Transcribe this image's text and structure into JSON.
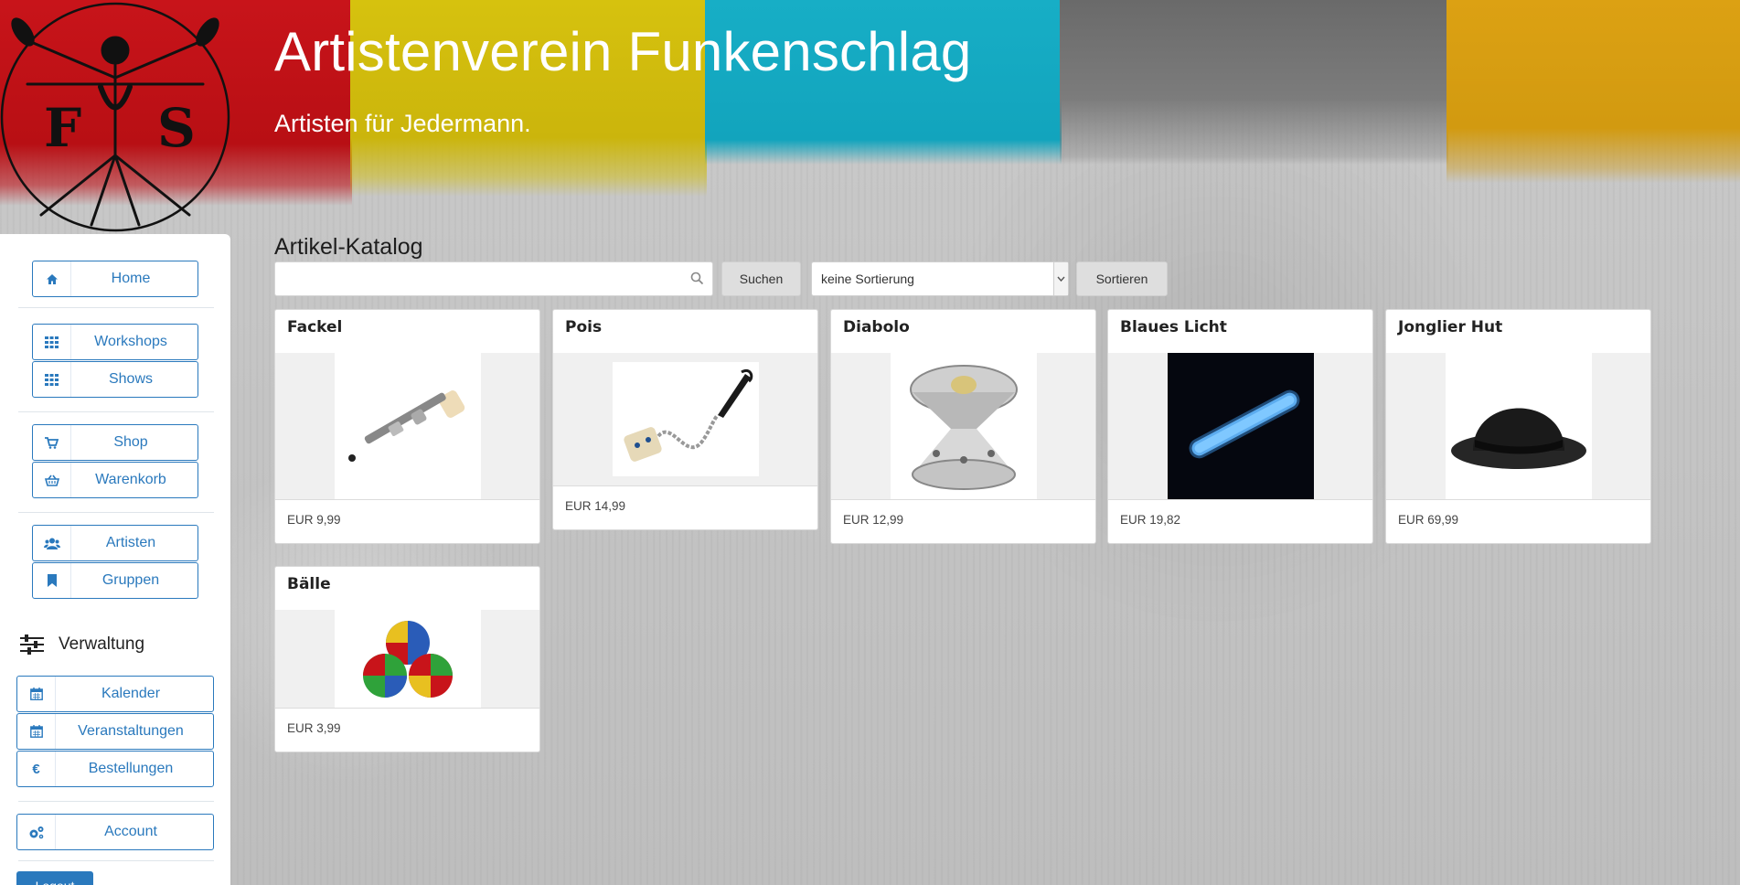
{
  "header": {
    "title": "Artistenverein Funkenschlag",
    "subtitle": "Artisten für Jedermann.",
    "logo_letters": [
      "F",
      "S"
    ]
  },
  "sidebar": {
    "groups": [
      [
        {
          "label": "Home",
          "icon": "home-icon"
        }
      ],
      [
        {
          "label": "Workshops",
          "icon": "grid-icon"
        },
        {
          "label": "Shows",
          "icon": "grid-icon"
        }
      ],
      [
        {
          "label": "Shop",
          "icon": "cart-icon"
        },
        {
          "label": "Warenkorb",
          "icon": "basket-icon"
        }
      ],
      [
        {
          "label": "Artisten",
          "icon": "users-icon"
        },
        {
          "label": "Gruppen",
          "icon": "bookmark-icon"
        }
      ]
    ],
    "admin_heading": "Verwaltung",
    "admin_items": [
      {
        "label": "Kalender",
        "icon": "calendar-icon"
      },
      {
        "label": "Veranstaltungen",
        "icon": "calendar-icon"
      },
      {
        "label": "Bestellungen",
        "icon": "euro-icon"
      }
    ],
    "account_label": "Account",
    "logout_label": "Logout"
  },
  "main": {
    "title": "Artikel-Katalog",
    "search": {
      "value": "",
      "button": "Suchen"
    },
    "sort": {
      "selected": "keine Sortierung",
      "button": "Sortieren"
    },
    "products": [
      {
        "name": "Fackel",
        "price": "EUR 9,99"
      },
      {
        "name": "Pois",
        "price": "EUR 14,99"
      },
      {
        "name": "Diabolo",
        "price": "EUR 12,99"
      },
      {
        "name": "Blaues Licht",
        "price": "EUR 19,82"
      },
      {
        "name": "Jonglier Hut",
        "price": "EUR 69,99"
      },
      {
        "name": "Bälle",
        "price": "EUR 3,99"
      }
    ]
  },
  "colors": {
    "accent": "#2a79bd",
    "red": "#c8141a",
    "yellow": "#d6c20e",
    "cyan": "#17aec6",
    "orange": "#dca113"
  }
}
